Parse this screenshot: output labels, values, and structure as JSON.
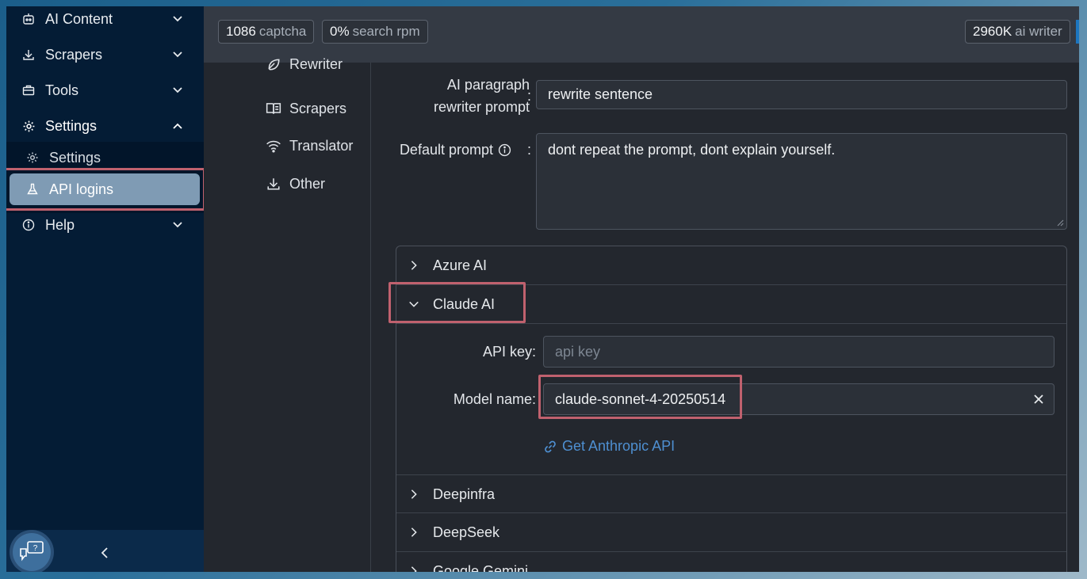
{
  "sidebar": {
    "items": [
      {
        "label": "AI Content",
        "icon": "robot-icon"
      },
      {
        "label": "Scrapers",
        "icon": "download-icon"
      },
      {
        "label": "Tools",
        "icon": "briefcase-icon"
      },
      {
        "label": "Settings",
        "icon": "gear-icon"
      },
      {
        "label": "Help",
        "icon": "info-icon"
      }
    ],
    "sub_items": [
      {
        "label": "Settings",
        "icon": "gear-icon"
      },
      {
        "label": "API logins",
        "icon": "flask-icon"
      }
    ],
    "collapse_label": "<"
  },
  "topbar": {
    "captcha_value": "1086",
    "captcha_unit": "captcha",
    "rpm_value": "0%",
    "rpm_unit": "search rpm",
    "writer_value": "2960K",
    "writer_unit": "ai writer"
  },
  "settings_nav": [
    {
      "label": "Rewriter",
      "icon": "leaf-icon"
    },
    {
      "label": "Scrapers",
      "icon": "book-icon"
    },
    {
      "label": "Translator",
      "icon": "wifi-icon"
    },
    {
      "label": "Other",
      "icon": "download-icon"
    }
  ],
  "form": {
    "paragraph_label_line1": "AI paragraph",
    "paragraph_label_line2": "rewriter prompt",
    "paragraph_value": "rewrite sentence",
    "default_prompt_label": "Default prompt",
    "default_prompt_value": "dont repeat the prompt, dont explain yourself."
  },
  "accordion": {
    "sections": [
      "Azure AI",
      "Claude AI",
      "Deepinfra",
      "DeepSeek",
      "Google Gemini"
    ],
    "claude": {
      "api_key_label": "API key",
      "api_key_placeholder": "api key",
      "model_name_label": "Model name",
      "model_name_value": "claude-sonnet-4-20250514",
      "link_text": "Get Anthropic API"
    }
  },
  "colors": {
    "sidebar_bg": "#041c35",
    "active_pill": "#7f9bb4",
    "highlight": "#c0616e",
    "link": "#4e8fd1"
  }
}
